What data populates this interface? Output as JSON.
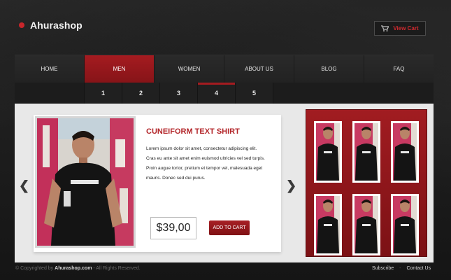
{
  "header": {
    "logo_text": "Ahurashop",
    "view_cart_label": "View Cart"
  },
  "nav": {
    "items": [
      {
        "label": "HOME"
      },
      {
        "label": "MEN"
      },
      {
        "label": "WOMEN"
      },
      {
        "label": "ABOUT US"
      },
      {
        "label": "BLOG"
      },
      {
        "label": "FAQ"
      }
    ],
    "active_item": "MEN"
  },
  "pager": {
    "pages": [
      "1",
      "2",
      "3",
      "4",
      "5"
    ],
    "active_page": "4"
  },
  "product": {
    "title": "CUNEIFORM TEXT SHIRT",
    "description": "Lorem ipsum dolor sit amet, consectetur adipiscing elit. Cras eu ante sit amet enim euismod ultricies vel sed turpis. Proin augue tortor, pretium et tempor vel, malesuada eget mauris. Donec sed dui purus.",
    "price": "$39,00",
    "add_to_cart_label": "ADD TO CART"
  },
  "carousel": {
    "prev_glyph": "❮",
    "next_glyph": "❯"
  },
  "gallery": {
    "thumbnail_count": 6
  },
  "footer": {
    "copyright_prefix": "© Copyrighted by",
    "copyright_site": "Ahurashop.com",
    "copyright_suffix": "- All Rights Reserved.",
    "links": [
      {
        "label": "Subscribe"
      },
      {
        "label": "Contact Us"
      }
    ],
    "separator": "-"
  },
  "colors": {
    "accent": "#a51b20",
    "background": "#161616",
    "panel": "#e8e8e8"
  },
  "icons": {
    "cart": "cart-icon",
    "logo_dot": "logo-dot"
  }
}
